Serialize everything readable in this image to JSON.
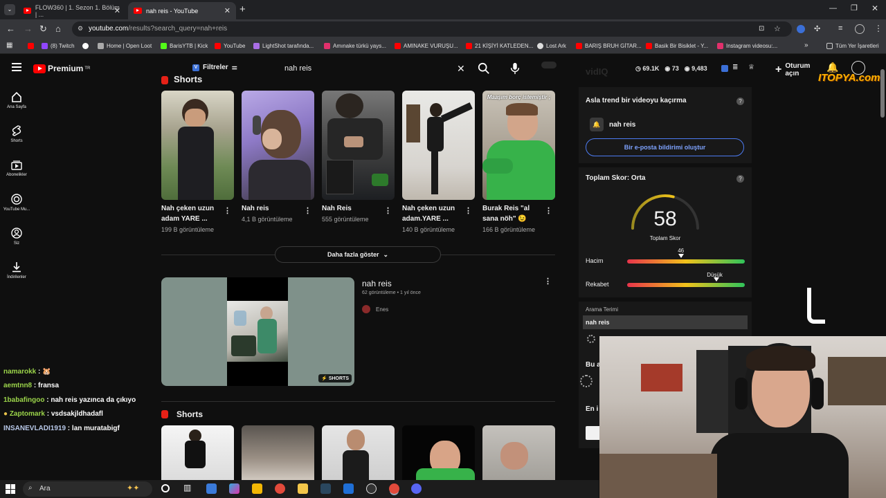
{
  "browser": {
    "tabs": [
      {
        "title": "FLOW360 | 1. Sezon 1. Bölüm | ..."
      },
      {
        "title": "nah reis - YouTube"
      }
    ],
    "url": {
      "host": "youtube.com",
      "path": "/results?search_query=nah+reis"
    },
    "bookmarks": [
      {
        "label": "(8) Twitch",
        "color": "#9146ff"
      },
      {
        "label": "Home | Open Loot",
        "color": "#aaaaaa"
      },
      {
        "label": "BarisYTB | Kick",
        "color": "#53fc18"
      },
      {
        "label": "YouTube",
        "color": "#ff0000"
      },
      {
        "label": "LightShot tarafında...",
        "color": "#a96ee6"
      },
      {
        "label": "Amınake türkü yays...",
        "color": "#e1306c"
      },
      {
        "label": "AMINAKE VURUŞU...",
        "color": "#ff0000"
      },
      {
        "label": "21 KİŞİYİ KATLEDEN...",
        "color": "#ff0000"
      },
      {
        "label": "Lost Ark",
        "color": "#dddddd"
      },
      {
        "label": "BARIŞ BRUH GİTAR...",
        "color": "#ff0000"
      },
      {
        "label": "Basik Bir Bisiklet - Y...",
        "color": "#ff0000"
      },
      {
        "label": "Instagram videosu:...",
        "color": "#e1306c"
      }
    ],
    "all_bookmarks_label": "Tüm Yer İşaretleri"
  },
  "youtube": {
    "logo_text": "Premium",
    "logo_sup": "TR",
    "filters_label": "Filtreler",
    "search_value": "nah reis",
    "vidiq_label": "vidIQ",
    "stats": [
      "69.1K",
      "73",
      "9,483"
    ],
    "signin_label": "Oturum açın",
    "sidebar": [
      {
        "label": "Ana Sayfa"
      },
      {
        "label": "Shorts"
      },
      {
        "label": "Abonelikler"
      },
      {
        "label": "YouTube Mu..."
      },
      {
        "label": "Siz"
      },
      {
        "label": "İndirilenler"
      }
    ],
    "shorts_header": "Shorts",
    "shorts": [
      {
        "title": "Nah çeken uzun adam YARE ...",
        "views": "199 B görüntüleme"
      },
      {
        "title": "Nah reis",
        "views": "4,1 B görüntüleme"
      },
      {
        "title": "Nah Reis",
        "views": "555 görüntüleme"
      },
      {
        "title": "Nah çeken uzun adam.YARE ...",
        "views": "140 B görüntüleme"
      },
      {
        "title": "Burak Reis \"al sana nöh\" 😉",
        "views": "166 B görüntüleme"
      }
    ],
    "short_overlay_text": "Maaşım borç istemiştir ;",
    "show_more_label": "Daha fazla göster",
    "video": {
      "title": "nah reis",
      "meta": "62 görüntüleme • 1 yıl önce",
      "channel": "Enes",
      "badge": "SHORTS"
    },
    "shorts_header_2": "Shorts"
  },
  "vidiq_panel": {
    "trend_title": "Asla trend bir videoyu kaçırma",
    "trend_keyword": "nah reis",
    "email_button": "Bir e-posta bildirimi oluştur",
    "score_title": "Toplam Skor: Orta",
    "score_value": "58",
    "score_value_number": 58,
    "score_label": "Toplam Skor",
    "volume_label": "Hacim",
    "volume_value": "46",
    "volume_fraction": 0.46,
    "competition_label": "Rekabet",
    "competition_value": "Düşük",
    "competition_fraction": 0.76,
    "search_term_label": "Arama Terimi",
    "search_term_value": "nah reis",
    "partial_label_1": "Bu a",
    "partial_label_2": "En i"
  },
  "overlay": {
    "watermark": "ITOPYA.com"
  },
  "chat": [
    {
      "user": "namarokk",
      "msg": "",
      "color": "#9bd44a"
    },
    {
      "user": "aemtnn8",
      "msg": "fransa",
      "color": "#9bd44a"
    },
    {
      "user": "1babafingoo",
      "msg": "nah reis yazınca da çıkıyo",
      "color": "#9bd44a"
    },
    {
      "user": "Zaptomark",
      "msg": "vsdsakjldhadafl",
      "color": "#9bd44a"
    },
    {
      "user": "INSANEVLADI1919",
      "msg": "lan muratabigf",
      "color": "#b8c8e8"
    }
  ],
  "taskbar": {
    "search_placeholder": "Ara"
  }
}
